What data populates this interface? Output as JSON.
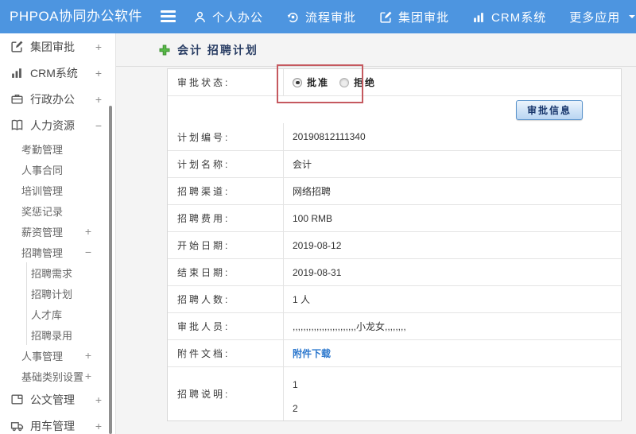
{
  "colors": {
    "header_bg": "#4d95e0",
    "annotation_red": "#c5595f",
    "link_blue": "#2b77cd",
    "plus_green": "#57b947",
    "title_text": "#2c4066"
  },
  "header": {
    "logo": "PHPOA协同办公软件",
    "nav": [
      {
        "name": "personal-office",
        "icon": "user-icon",
        "label": "个人办公"
      },
      {
        "name": "process-approval",
        "icon": "process-icon",
        "label": "流程审批"
      },
      {
        "name": "group-approval",
        "icon": "edit-square-icon",
        "label": "集团审批"
      },
      {
        "name": "crm-system",
        "icon": "bar-chart-icon",
        "label": "CRM系统"
      },
      {
        "name": "more-apps",
        "icon": "",
        "label": "更多应用",
        "caret": true
      }
    ]
  },
  "sidebar": {
    "items": [
      {
        "name": "group-approval",
        "level": 0,
        "icon": "edit-square-icon",
        "label": "集团审批",
        "expand": "+"
      },
      {
        "name": "crm-system",
        "level": 0,
        "icon": "bar-chart-icon",
        "label": "CRM系统",
        "expand": "+"
      },
      {
        "name": "admin-office",
        "level": 0,
        "icon": "briefcase-icon",
        "label": "行政办公",
        "expand": "+"
      },
      {
        "name": "human-resources",
        "level": 0,
        "icon": "book-icon",
        "label": "人力资源",
        "expand": "−"
      },
      {
        "name": "attendance-mgmt",
        "level": 1,
        "label": "考勤管理"
      },
      {
        "name": "hr-contract",
        "level": 1,
        "label": "人事合同"
      },
      {
        "name": "training-mgmt",
        "level": 1,
        "label": "培训管理"
      },
      {
        "name": "reward-punish-records",
        "level": 1,
        "label": "奖惩记录"
      },
      {
        "name": "salary-mgmt",
        "level": 1,
        "label": "薪资管理",
        "expand": "+"
      },
      {
        "name": "recruit-mgmt",
        "level": 1,
        "label": "招聘管理",
        "expand": "−"
      },
      {
        "name": "recruit-demand",
        "level": 2,
        "label": "招聘需求"
      },
      {
        "name": "recruit-plan",
        "level": 2,
        "label": "招聘计划"
      },
      {
        "name": "talent-pool",
        "level": 2,
        "label": "人才库"
      },
      {
        "name": "recruit-hiring",
        "level": 2,
        "label": "招聘录用"
      },
      {
        "name": "personnel-mgmt",
        "level": 1,
        "label": "人事管理",
        "expand": "+"
      },
      {
        "name": "basic-category-settings",
        "level": 1,
        "label": "基础类别设置",
        "expand": "+"
      },
      {
        "name": "document-mgmt",
        "level": 0,
        "icon": "document-icon",
        "label": "公文管理",
        "expand": "+"
      },
      {
        "name": "vehicle-mgmt",
        "level": 0,
        "icon": "truck-icon",
        "label": "用车管理",
        "expand": "+"
      }
    ]
  },
  "main": {
    "title": "会计 招聘计划",
    "approval": {
      "label": "审批状态:",
      "options": [
        {
          "label": "批准",
          "selected": true
        },
        {
          "label": "拒绝",
          "selected": false
        }
      ]
    },
    "approve_button": "审批信息",
    "fields": [
      {
        "name": "plan-number",
        "label": "计划编号:",
        "value": "20190812111340"
      },
      {
        "name": "plan-name",
        "label": "计划名称:",
        "value": "会计"
      },
      {
        "name": "recruit-channel",
        "label": "招聘渠道:",
        "value": "网络招聘"
      },
      {
        "name": "recruit-cost",
        "label": "招聘费用:",
        "value": "100 RMB"
      },
      {
        "name": "start-date",
        "label": "开始日期:",
        "value": "2019-08-12"
      },
      {
        "name": "end-date",
        "label": "结束日期:",
        "value": "2019-08-31"
      },
      {
        "name": "recruit-headcount",
        "label": "招聘人数:",
        "value": "1 人"
      },
      {
        "name": "approvers",
        "label": "审批人员:",
        "value": ",,,,,,,,,,,,,,,,,,,,,,,,小龙女,,,,,,,,"
      },
      {
        "name": "attachment",
        "label": "附件文档:",
        "value": "附件下载",
        "type": "link"
      },
      {
        "name": "recruit-description",
        "label": "招聘说明:",
        "value": [
          "1",
          "2"
        ],
        "type": "multiline"
      }
    ]
  }
}
